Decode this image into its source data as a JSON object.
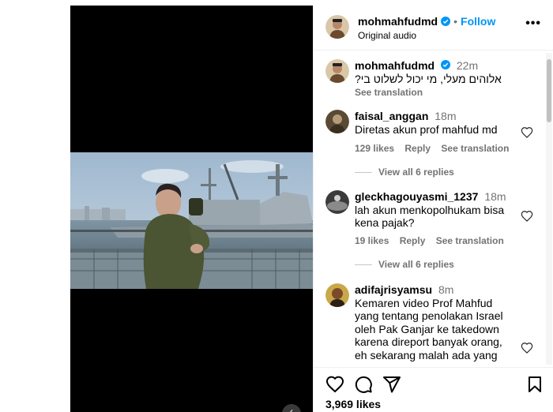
{
  "post": {
    "username": "mohmahfudmd",
    "follow_label": "Follow",
    "separator": "•",
    "audio": "Original audio",
    "likes": "3,969 likes"
  },
  "caption": {
    "username": "mohmahfudmd",
    "time": "22m",
    "text": "?אלוהים מעלי, מי יכול לשלוט בי",
    "see_translation": "See translation"
  },
  "comments": [
    {
      "username": "faisal_anggan",
      "time": "18m",
      "text": "Diretas akun prof mahfud md",
      "likes": "129 likes",
      "reply": "Reply",
      "see_translation": "See translation",
      "view_replies": "View all 6 replies"
    },
    {
      "username": "gleckhagouyasmi_1237",
      "time": "18m",
      "text": "lah akun menkopolhukam bisa kena pajak?",
      "likes": "19 likes",
      "reply": "Reply",
      "see_translation": "See translation",
      "view_replies": "View all 6 replies"
    },
    {
      "username": "adifajrisyamsu",
      "time": "8m",
      "text": "Kemaren video Prof Mahfud yang tentang penolakan Israel oleh Pak Ganjar ke takedown karena direport banyak orang, eh sekarang malah ada yang main"
    }
  ],
  "icons": {
    "verified": "verified-badge-icon",
    "more": "more-options-icon",
    "heart": "heart-icon",
    "comment": "comment-icon",
    "share": "share-icon",
    "save": "bookmark-icon"
  },
  "colors": {
    "accent": "#0095f6",
    "muted": "#737373",
    "border": "#efefef",
    "media_bg": "#000000"
  }
}
